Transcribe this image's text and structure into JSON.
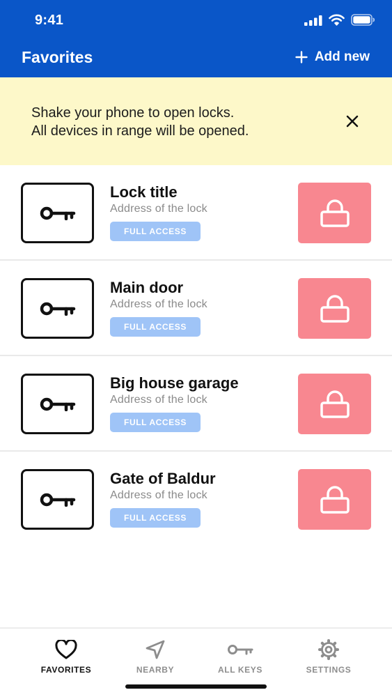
{
  "status_bar": {
    "time": "9:41"
  },
  "header": {
    "title": "Favorites",
    "add_new_label": "Add new"
  },
  "banner": {
    "line1": "Shake your phone to open locks.",
    "line2": "All devices in range will be opened."
  },
  "locks": [
    {
      "title": "Lock title",
      "address": "Address of the lock",
      "access": "FULL ACCESS"
    },
    {
      "title": "Main door",
      "address": "Address of the lock",
      "access": "FULL ACCESS"
    },
    {
      "title": "Big house garage",
      "address": "Address of the lock",
      "access": "FULL ACCESS"
    },
    {
      "title": "Gate of Baldur",
      "address": "Address of the lock",
      "access": "FULL ACCESS"
    }
  ],
  "tabs": [
    {
      "label": "FAVORITES",
      "icon": "heart-icon",
      "active": true
    },
    {
      "label": "NEARBY",
      "icon": "navigation-arrow-icon",
      "active": false
    },
    {
      "label": "ALL KEYS",
      "icon": "key-icon",
      "active": false
    },
    {
      "label": "SETTINGS",
      "icon": "gear-icon",
      "active": false
    }
  ],
  "colors": {
    "header_bg": "#0a56c8",
    "banner_bg": "#fdf8c9",
    "lock_button": "#f88790",
    "access_badge": "#9fc4f7"
  }
}
